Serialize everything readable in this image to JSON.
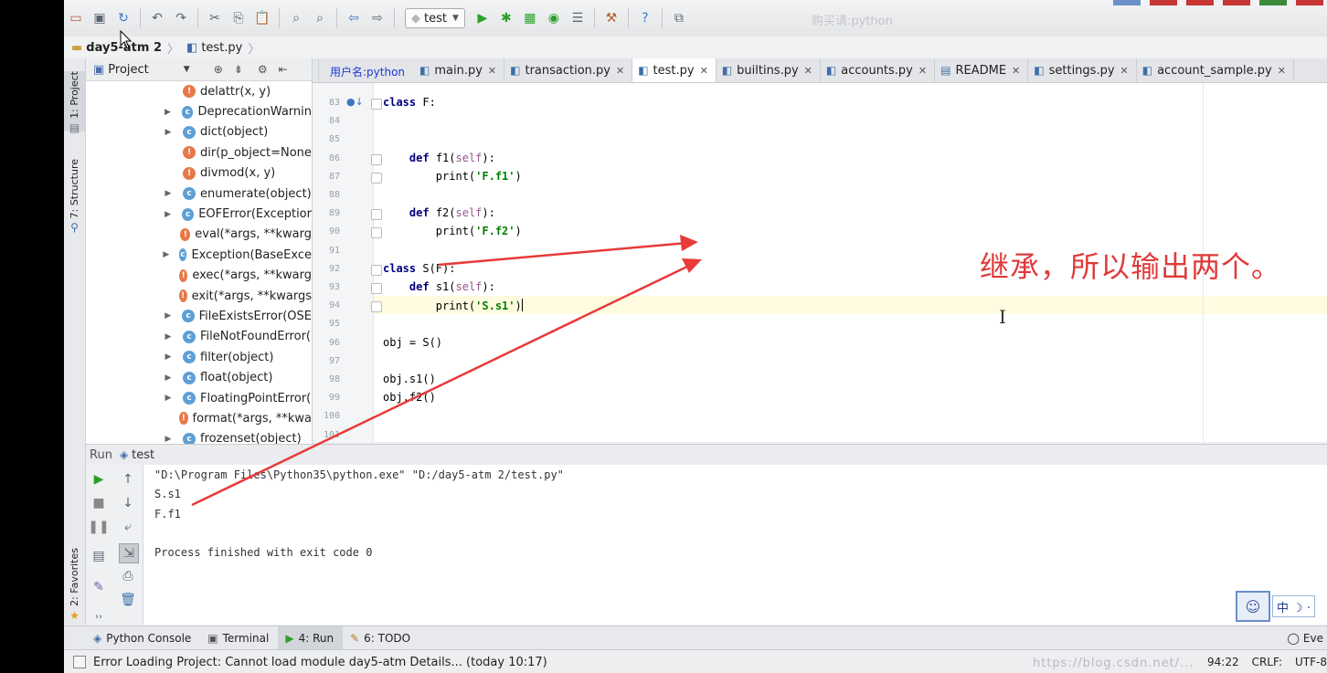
{
  "toolbar": {
    "run_config": "test",
    "watermark": "购买请:python"
  },
  "breadcrumb": {
    "project": "day5-atm 2",
    "file": "test.py"
  },
  "left_strip": {
    "project_tab": "1: Project",
    "structure_tab": "7: Structure",
    "favorites_tab": "2: Favorites"
  },
  "project_panel": {
    "title": "Project",
    "items": [
      {
        "label": "delattr(x, y)",
        "kind": "f",
        "expandable": false
      },
      {
        "label": "DeprecationWarnin",
        "kind": "c",
        "expandable": true
      },
      {
        "label": "dict(object)",
        "kind": "c",
        "expandable": true
      },
      {
        "label": "dir(p_object=None",
        "kind": "f",
        "expandable": false
      },
      {
        "label": "divmod(x, y)",
        "kind": "f",
        "expandable": false
      },
      {
        "label": "enumerate(object)",
        "kind": "c",
        "expandable": true
      },
      {
        "label": "EOFError(Exceptior",
        "kind": "c",
        "expandable": true
      },
      {
        "label": "eval(*args, **kwarg",
        "kind": "f",
        "expandable": false
      },
      {
        "label": "Exception(BaseExce",
        "kind": "c",
        "expandable": true
      },
      {
        "label": "exec(*args, **kwarg",
        "kind": "f",
        "expandable": false
      },
      {
        "label": "exit(*args, **kwargs",
        "kind": "f",
        "expandable": false
      },
      {
        "label": "FileExistsError(OSE",
        "kind": "c",
        "expandable": true
      },
      {
        "label": "FileNotFoundError(",
        "kind": "c",
        "expandable": true
      },
      {
        "label": "filter(object)",
        "kind": "c",
        "expandable": true
      },
      {
        "label": "float(object)",
        "kind": "c",
        "expandable": true
      },
      {
        "label": "FloatingPointError(",
        "kind": "c",
        "expandable": true
      },
      {
        "label": "format(*args, **kwa",
        "kind": "f",
        "expandable": false
      },
      {
        "label": "frozenset(object)",
        "kind": "c",
        "expandable": true
      }
    ]
  },
  "editor_tabs": [
    {
      "label": "main.py",
      "overlay": "用户名:python"
    },
    {
      "label": "transaction.py"
    },
    {
      "label": "test.py",
      "active": true
    },
    {
      "label": "builtins.py"
    },
    {
      "label": "accounts.py"
    },
    {
      "label": "README"
    },
    {
      "label": "settings.py"
    },
    {
      "label": "account_sample.py"
    }
  ],
  "code_lines": [
    {
      "n": "83",
      "text": "class F:"
    },
    {
      "n": "84",
      "text": ""
    },
    {
      "n": "85",
      "text": ""
    },
    {
      "n": "86",
      "text": "    def f1(self):"
    },
    {
      "n": "87",
      "text": "        print('F.f1')"
    },
    {
      "n": "88",
      "text": ""
    },
    {
      "n": "89",
      "text": "    def f2(self):"
    },
    {
      "n": "90",
      "text": "        print('F.f2')"
    },
    {
      "n": "91",
      "text": ""
    },
    {
      "n": "92",
      "text": "class S(F):"
    },
    {
      "n": "93",
      "text": "    def s1(self):"
    },
    {
      "n": "94",
      "text": "        print('S.s1')"
    },
    {
      "n": "95",
      "text": ""
    },
    {
      "n": "96",
      "text": "obj = S()"
    },
    {
      "n": "97",
      "text": ""
    },
    {
      "n": "98",
      "text": "obj.s1()"
    },
    {
      "n": "99",
      "text": "obj.f2()"
    },
    {
      "n": "100",
      "text": ""
    },
    {
      "n": "101",
      "text": ""
    }
  ],
  "annotation": "继承，所以输出两个。",
  "run_panel": {
    "label": "Run",
    "config": "test",
    "console": [
      "\"D:\\Program Files\\Python35\\python.exe\" \"D:/day5-atm 2/test.py\"",
      "S.s1",
      "F.f1",
      "",
      "Process finished with exit code 0"
    ]
  },
  "ime": {
    "text": "中 ☽ ·"
  },
  "bottom_tabs": [
    {
      "label": "Python Console"
    },
    {
      "label": "Terminal"
    },
    {
      "label": "4: Run",
      "active": true
    },
    {
      "label": "6: TODO"
    }
  ],
  "event_log": "Eve",
  "status": {
    "message": "Error Loading Project: Cannot load module day5-atm Details... (today 10:17)",
    "position": "94:22",
    "line_sep": "CRLF:",
    "encoding": "UTF-8",
    "watermark": "https://blog.csdn.net/..."
  },
  "colors": {
    "annotation": "#e03a3a",
    "active_run": "#2aa02a",
    "code_keyword": "#000080",
    "code_string": "#008000"
  }
}
